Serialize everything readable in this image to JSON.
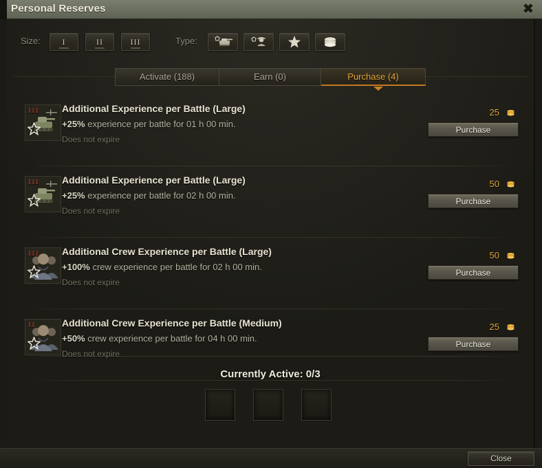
{
  "window": {
    "title": "Personal Reserves",
    "close_icon": "close-x-icon",
    "close_button_label": "Close"
  },
  "filters": {
    "size_label": "Size:",
    "size_options": [
      {
        "label": "I",
        "name": "size-1"
      },
      {
        "label": "II",
        "name": "size-2"
      },
      {
        "label": "III",
        "name": "size-3"
      }
    ],
    "type_label": "Type:",
    "type_options": [
      {
        "icon": "tank-experience-icon"
      },
      {
        "icon": "crew-experience-icon"
      },
      {
        "icon": "free-experience-star-icon"
      },
      {
        "icon": "credits-stack-icon"
      }
    ]
  },
  "tabs": [
    {
      "label": "Activate (188)",
      "active": false
    },
    {
      "label": "Earn (0)",
      "active": false
    },
    {
      "label": "Purchase (4)",
      "active": true
    }
  ],
  "reserves": [
    {
      "title": "Additional Experience per Battle (Large)",
      "bonus": "+25%",
      "description": " experience per battle for 01 h 00 min.",
      "expiry": "Does not expire",
      "price": "25",
      "currency_icon": "gold-coin-stack-icon",
      "button_label": "Purchase",
      "icon": "tank-reserve-icon",
      "marks": "III"
    },
    {
      "title": "Additional Experience per Battle (Large)",
      "bonus": "+25%",
      "description": " experience per battle for 02 h 00 min.",
      "expiry": "Does not expire",
      "price": "50",
      "currency_icon": "gold-coin-stack-icon",
      "button_label": "Purchase",
      "icon": "tank-reserve-icon",
      "marks": "III"
    },
    {
      "title": "Additional Crew Experience per Battle (Large)",
      "bonus": "+100%",
      "description": " crew experience per battle for 02 h 00 min.",
      "expiry": "Does not expire",
      "price": "50",
      "currency_icon": "gold-coin-stack-icon",
      "button_label": "Purchase",
      "icon": "crew-reserve-icon",
      "marks": "III"
    },
    {
      "title": "Additional Crew Experience per Battle (Medium)",
      "bonus": "+50%",
      "description": " crew experience per battle for 04 h 00 min.",
      "expiry": "Does not expire",
      "price": "25",
      "currency_icon": "gold-coin-stack-icon",
      "button_label": "Purchase",
      "icon": "crew-reserve-icon",
      "marks": "II"
    }
  ],
  "footer": {
    "active_label": "Currently Active: 0/3",
    "slots": [
      {
        "name": "slot-1",
        "filled": false
      },
      {
        "name": "slot-2",
        "filled": false
      },
      {
        "name": "slot-3",
        "filled": false
      }
    ]
  },
  "colors": {
    "accent": "#e3a93c",
    "gold": "#e0a53a",
    "titlebar": "#6e7260",
    "background": "#1c1b16"
  }
}
